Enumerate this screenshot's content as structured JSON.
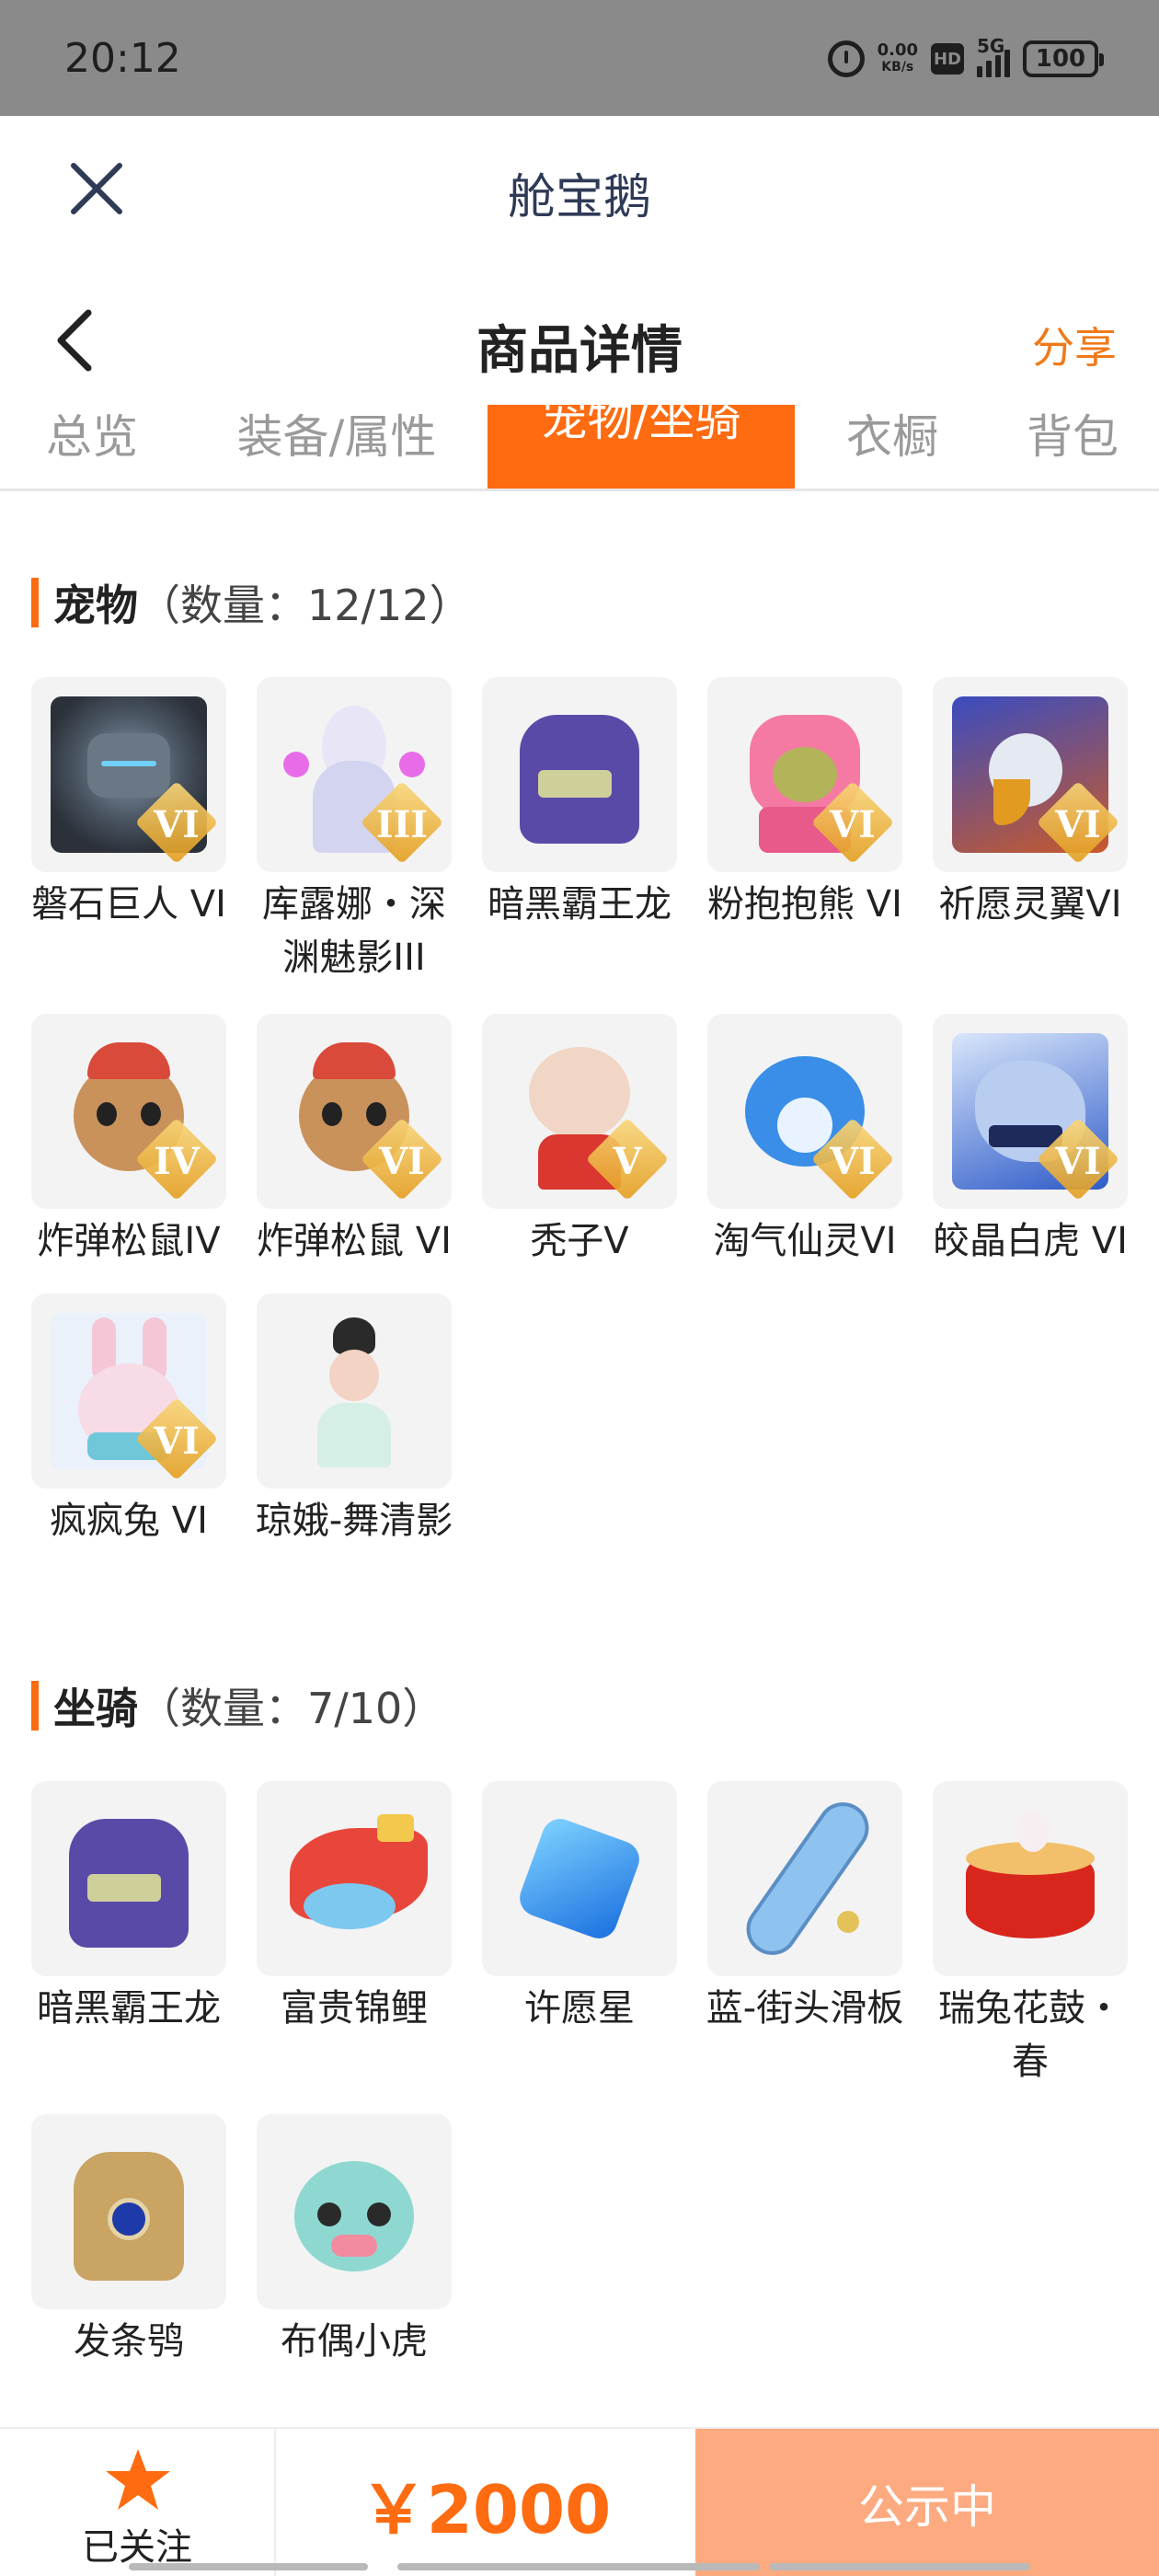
{
  "status_bar": {
    "time": "20:12",
    "speed_value": "0.00",
    "speed_unit": "KB/s",
    "hd_label": "HD",
    "network": "5G",
    "battery": "100"
  },
  "app": {
    "title": "舱宝鹅"
  },
  "nav": {
    "title": "商品详情",
    "share": "分享"
  },
  "tabs": [
    "总览",
    "装备/属性",
    "宠物/坐骑",
    "衣橱",
    "背包"
  ],
  "active_tab": "宠物/坐骑",
  "pets": {
    "title": "宠物",
    "count": "（数量：12/12）",
    "items": [
      {
        "name": "磐石巨人 VI",
        "grade": "VI"
      },
      {
        "name": "库露娜・深渊魅影III",
        "grade": "III"
      },
      {
        "name": "暗黑霸王龙",
        "grade": ""
      },
      {
        "name": "粉抱抱熊 VI",
        "grade": "VI"
      },
      {
        "name": "祈愿灵翼VI",
        "grade": "VI"
      },
      {
        "name": "炸弹松鼠IV",
        "grade": "IV"
      },
      {
        "name": "炸弹松鼠 VI",
        "grade": "VI"
      },
      {
        "name": "秃子V",
        "grade": "V"
      },
      {
        "name": "淘气仙灵VI",
        "grade": "VI"
      },
      {
        "name": "皎晶白虎 VI",
        "grade": "VI"
      },
      {
        "name": "疯疯兔 VI",
        "grade": "VI"
      },
      {
        "name": "琼娥-舞清影",
        "grade": ""
      }
    ]
  },
  "mounts": {
    "title": "坐骑",
    "count": "（数量：7/10）",
    "items": [
      {
        "name": "暗黑霸王龙"
      },
      {
        "name": "富贵锦鲤"
      },
      {
        "name": "许愿星"
      },
      {
        "name": "蓝-街头滑板"
      },
      {
        "name": "瑞兔花鼓・春"
      },
      {
        "name": "发条鸮"
      },
      {
        "name": "布偶小虎"
      }
    ]
  },
  "bottom": {
    "follow_label": "已关注",
    "price": "￥2000",
    "status": "公示中"
  },
  "colors": {
    "accent": "#fe6b10",
    "status_button": "#fdaa80",
    "app_title": "#2f3a56"
  }
}
